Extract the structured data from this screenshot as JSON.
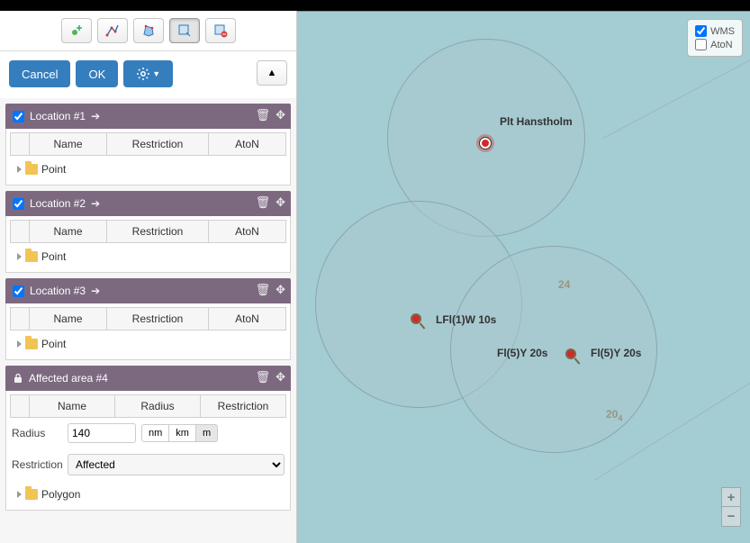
{
  "buttons": {
    "cancel": "Cancel",
    "ok": "OK"
  },
  "section1": {
    "title": "Location #1",
    "cols": {
      "name": "Name",
      "restriction": "Restriction",
      "aton": "AtoN"
    },
    "nodeType": "Point"
  },
  "section2": {
    "title": "Location #2",
    "cols": {
      "name": "Name",
      "restriction": "Restriction",
      "aton": "AtoN"
    },
    "nodeType": "Point"
  },
  "section3": {
    "title": "Location #3",
    "cols": {
      "name": "Name",
      "restriction": "Restriction",
      "aton": "AtoN"
    },
    "nodeType": "Point"
  },
  "affected": {
    "title": "Affected area #4",
    "cols": {
      "name": "Name",
      "radius": "Radius",
      "restriction": "Restriction"
    },
    "radiusLabel": "Radius",
    "radiusValue": "140",
    "units": {
      "nm": "nm",
      "km": "km",
      "m": "m"
    },
    "restrictionLabel": "Restriction",
    "restrictionValue": "Affected",
    "nodeType": "Polygon"
  },
  "layers": {
    "wms": "WMS",
    "aton": "AtoN"
  },
  "map": {
    "label_hanstholm": "Plt Hanstholm",
    "label_lfl": "LFl(1)W 10s",
    "label_fl1": "Fl(5)Y 20s",
    "label_fl2": "Fl(5)Y 20s",
    "depth1": "24",
    "depth2": "20",
    "depth2sub": "4"
  }
}
